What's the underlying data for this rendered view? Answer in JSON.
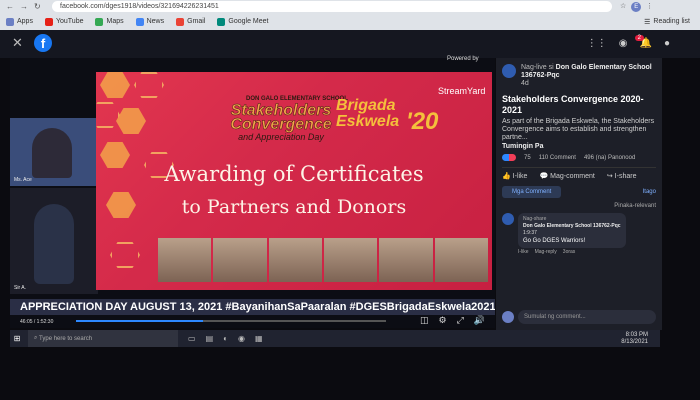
{
  "browser": {
    "url": "facebook.com/dges1918/videos/321694226231451",
    "profile_initial": "E",
    "bookmarks": [
      {
        "label": "Apps",
        "color": "#6b7fc4"
      },
      {
        "label": "YouTube",
        "color": "#e62117"
      },
      {
        "label": "Maps",
        "color": "#34a853"
      },
      {
        "label": "News",
        "color": "#4285f4"
      },
      {
        "label": "Gmail",
        "color": "#ea4335"
      },
      {
        "label": "Google Meet",
        "color": "#00897b"
      }
    ],
    "reading_list": "Reading list"
  },
  "fb": {
    "logo": "f",
    "notif_count": "2"
  },
  "video": {
    "powered_by": "Powered by",
    "streamyard": "StreamYard",
    "slide": {
      "school": "DON GALO ELEMENTARY SCHOOL",
      "stakeholders": "Stakeholders Convergence",
      "appreciation": "and Appreciation Day",
      "brigada": "Brigada Eskwela",
      "year": "'20",
      "heading1": "Awarding of Certificates",
      "heading2": "to Partners and Donors"
    },
    "cam1_label": "Ms. Ace",
    "cam2_label": "Sir A.",
    "ticker": "APPRECIATION DAY AUGUST 13, 2021 #BayanihanSaPaaralan #DGESBrigadaEskwela2021",
    "time": "46:05 / 1:52:30",
    "progress": 0.41
  },
  "panel": {
    "page_prefix": "Nag-live si",
    "page_name": "Don Galo Elementary School 136762-Pqc",
    "age": "4d",
    "title": "Stakeholders Convergence 2020-2021",
    "description": "As part of the Brigada Eskwela, the Stakeholders Convergence aims to establish and strengthen partne...",
    "see_more": "Tumingin Pa",
    "reactions": "75",
    "comments": "110 Comment",
    "views": "496 (na) Panonood",
    "actions": [
      "I-like",
      "Mag-comment",
      "I-share"
    ],
    "tab_comment": "Mga Comment",
    "tab_other": "Itago",
    "sort": "Pinaka-relevant",
    "comment": {
      "tag": "Nag-share",
      "author": "Don Galo Elementary School 136762-Pqc",
      "time": "1:9:37",
      "text": "Go Go DGES Warriors!",
      "like": "I-like",
      "reply": "Mag-reply",
      "ago": "3oras"
    },
    "write_placeholder": "Sumulat ng comment..."
  },
  "taskbar": {
    "search_placeholder": "Type here to search",
    "time": "8:03 PM",
    "date": "8/13/2021"
  }
}
